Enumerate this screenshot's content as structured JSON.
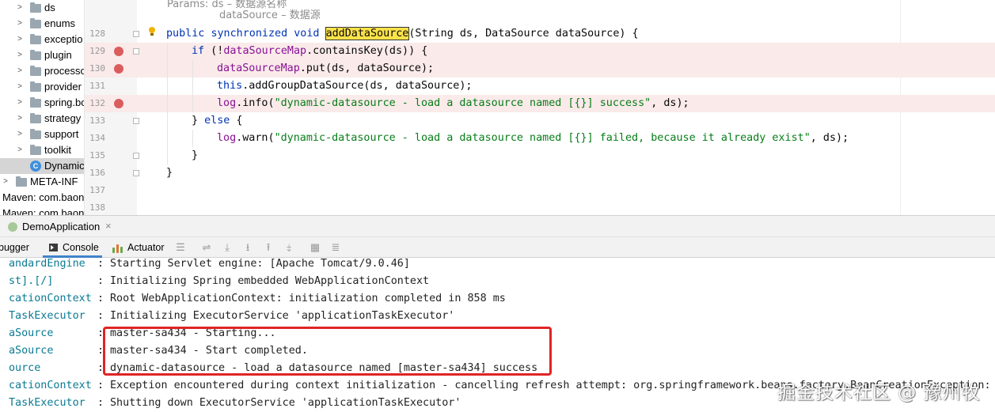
{
  "tree": {
    "items": [
      {
        "label": "ds",
        "type": "folder"
      },
      {
        "label": "enums",
        "type": "folder"
      },
      {
        "label": "exceptio",
        "type": "folder"
      },
      {
        "label": "plugin",
        "type": "folder"
      },
      {
        "label": "processo",
        "type": "folder"
      },
      {
        "label": "provider",
        "type": "folder"
      },
      {
        "label": "spring.bo",
        "type": "folder"
      },
      {
        "label": "strategy",
        "type": "folder"
      },
      {
        "label": "support",
        "type": "folder"
      },
      {
        "label": "toolkit",
        "type": "folder"
      },
      {
        "label": "Dynamic",
        "type": "class",
        "selected": true
      },
      {
        "label": "META-INF",
        "type": "folder"
      },
      {
        "label": "Maven: com.baon",
        "type": "lib"
      },
      {
        "label": "Maven: com.baon",
        "type": "lib"
      }
    ]
  },
  "editor": {
    "doc_lines": [
      "Params: ds – 数据源名称",
      "dataSource – 数据源"
    ],
    "lines": [
      {
        "num": "128",
        "breakpoint": false,
        "bulb": true
      },
      {
        "num": "129",
        "breakpoint": true
      },
      {
        "num": "130",
        "breakpoint": true
      },
      {
        "num": "131",
        "breakpoint": false
      },
      {
        "num": "132",
        "breakpoint": true
      },
      {
        "num": "133",
        "breakpoint": false
      },
      {
        "num": "134",
        "breakpoint": false
      },
      {
        "num": "135",
        "breakpoint": false
      },
      {
        "num": "136",
        "breakpoint": false
      },
      {
        "num": "137",
        "breakpoint": false
      },
      {
        "num": "138",
        "breakpoint": false
      }
    ],
    "code": {
      "l128_kw1": "public",
      "l128_kw2": "synchronized",
      "l128_kw3": "void",
      "l128_method": "addDataSource",
      "l128_rest": "(String ds, DataSource dataSource) {",
      "l129_kw": "if",
      "l129_a": " (!",
      "l129_field": "dataSourceMap",
      "l129_b": ".containsKey(ds)) {",
      "l130_field": "dataSourceMap",
      "l130_rest": ".put(ds, dataSource);",
      "l131_kw": "this",
      "l131_rest": ".addGroupDataSource(ds, dataSource);",
      "l132_field": "log",
      "l132_a": ".info(",
      "l132_str": "\"dynamic-datasource - load a datasource named [{}] success\"",
      "l132_b": ", ds);",
      "l133_a": "} ",
      "l133_kw": "else",
      "l133_b": " {",
      "l134_field": "log",
      "l134_a": ".warn(",
      "l134_str": "\"dynamic-datasource - load a datasource named [{}] failed, because it already exist\"",
      "l134_b": ", ds);",
      "l135": "}",
      "l136": "}"
    }
  },
  "run": {
    "config_name": "DemoApplication",
    "close_glyph": "×",
    "tabs": [
      {
        "label": "bugger",
        "active": false
      },
      {
        "label": "Console",
        "active": true
      },
      {
        "label": "Actuator",
        "active": false
      }
    ],
    "toolbar": [
      "menu-icon",
      "soft-wrap-icon",
      "scroll-down-icon",
      "download-icon",
      "upload-icon",
      "filter-icon",
      "print-icon",
      "clear-all-icon"
    ]
  },
  "console": {
    "lines": [
      {
        "src": "andardEngine",
        "msg": "Starting Servlet engine: [Apache Tomcat/9.0.46]"
      },
      {
        "src": "st].[/]",
        "msg": "Initializing Spring embedded WebApplicationContext"
      },
      {
        "src": "cationContext",
        "msg": "Root WebApplicationContext: initialization completed in 858 ms"
      },
      {
        "src": "TaskExecutor",
        "msg": "Initializing ExecutorService 'applicationTaskExecutor'"
      },
      {
        "src": "aSource",
        "msg": "master-sa434 - Starting..."
      },
      {
        "src": "aSource",
        "msg": "master-sa434 - Start completed."
      },
      {
        "src": "ource",
        "msg": "dynamic-datasource - load a datasource named [master-sa434] success"
      },
      {
        "src": "cationContext",
        "msg": "Exception encountered during context initialization - cancelling refresh attempt: org.springframework.beans.factory.BeanCreationException: E"
      },
      {
        "src": "TaskExecutor",
        "msg": "Shutting down ExecutorService 'applicationTaskExecutor'"
      }
    ]
  },
  "watermark": "掘金技术社区 @ 豫州牧",
  "colors": {
    "keyword": "#0033b3",
    "field": "#871094",
    "string": "#067d17",
    "breakpoint": "#db5c5c",
    "log_source": "#0a7a93",
    "highlight_box": "#e02424",
    "tab_accent": "#4083c9"
  }
}
